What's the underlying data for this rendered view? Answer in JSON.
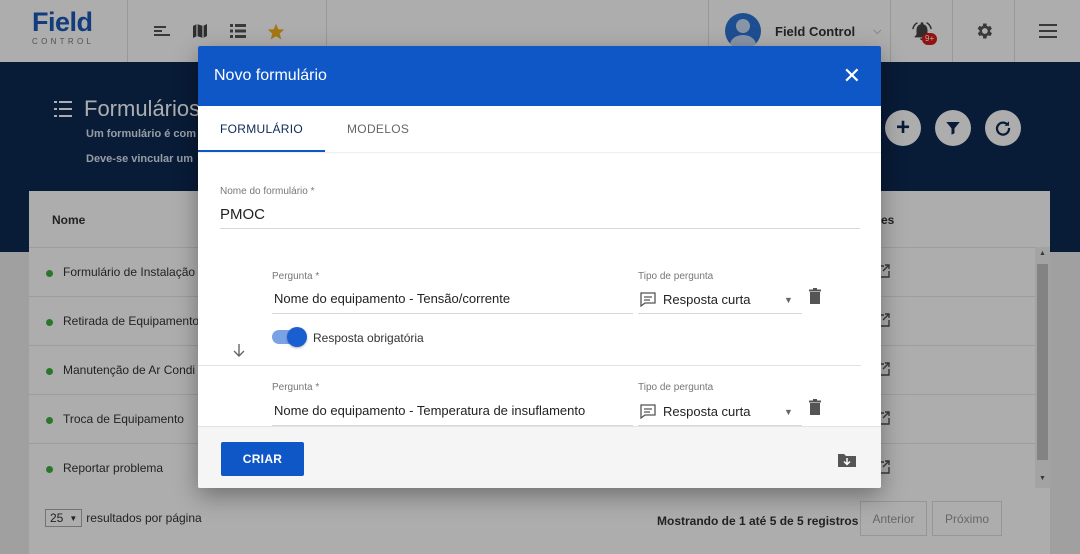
{
  "app": {
    "logo_main": "Field",
    "logo_sub": "CONTROL",
    "user_name": "Field Control",
    "notif_badge": "9+",
    "icons": [
      "filter-list-icon",
      "map-icon",
      "list-icon",
      "star-icon"
    ]
  },
  "page": {
    "title": "Formulários",
    "desc_line1": "Um formulário é com",
    "desc_line2": "Deve-se vincular um"
  },
  "table": {
    "header_name": "Nome",
    "header_right": "es",
    "rows": [
      {
        "name": "Formulário de Instalação"
      },
      {
        "name": "Retirada de Equipamento"
      },
      {
        "name": "Manutenção de Ar Condi"
      },
      {
        "name": "Troca de Equipamento"
      },
      {
        "name": "Reportar problema"
      }
    ],
    "per_page_value": "25",
    "per_page_label": "resultados por página",
    "showing": "Mostrando de 1 até 5 de 5 registros",
    "prev": "Anterior",
    "next": "Próximo"
  },
  "modal": {
    "title": "Novo formulário",
    "close": "✕",
    "tabs": [
      {
        "label": "FORMULÁRIO",
        "active": true
      },
      {
        "label": "MODELOS",
        "active": false
      }
    ],
    "form_name_label": "Nome do formulário *",
    "form_name_value": "PMOC",
    "questions": [
      {
        "question_label": "Pergunta *",
        "question_value": "Nome do equipamento - Tensão/corrente",
        "type_label": "Tipo de pergunta",
        "type_value": "Resposta curta",
        "required_label": "Resposta obrigatória",
        "required": true
      },
      {
        "question_label": "Pergunta *",
        "question_value": "Nome do equipamento - Temperatura de insuflamento",
        "type_label": "Tipo de pergunta",
        "type_value": "Resposta curta"
      }
    ],
    "submit_label": "CRIAR"
  },
  "colors": {
    "brand": "#1a5bb8",
    "modal_header": "#0f57c7",
    "hero": "#0c2952",
    "status_dot": "#3fae3f"
  }
}
